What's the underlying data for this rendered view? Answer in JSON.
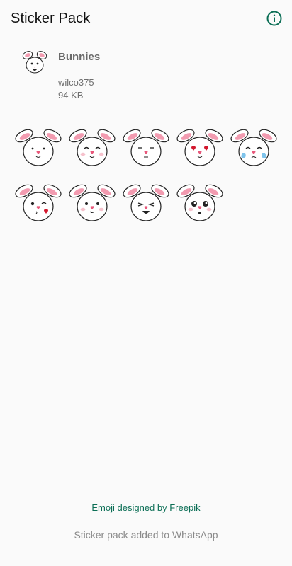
{
  "app": {
    "title": "Sticker Pack"
  },
  "icons": {
    "info": "info-circle-icon"
  },
  "colors": {
    "accent": "#0b6e55",
    "tray_accent": "#e05a7a"
  },
  "pack": {
    "name": "Bunnies",
    "publisher": "wilco375",
    "size": "94  KB",
    "tray_icon": "bunny-tray-icon"
  },
  "stickers": [
    {
      "expression": "plain"
    },
    {
      "expression": "happy"
    },
    {
      "expression": "calm"
    },
    {
      "expression": "love"
    },
    {
      "expression": "crying"
    },
    {
      "expression": "wink-kiss"
    },
    {
      "expression": "smile"
    },
    {
      "expression": "laugh"
    },
    {
      "expression": "surprised"
    }
  ],
  "footer": {
    "credit_link": "Emoji designed by Freepik",
    "status": "Sticker pack added to WhatsApp"
  }
}
